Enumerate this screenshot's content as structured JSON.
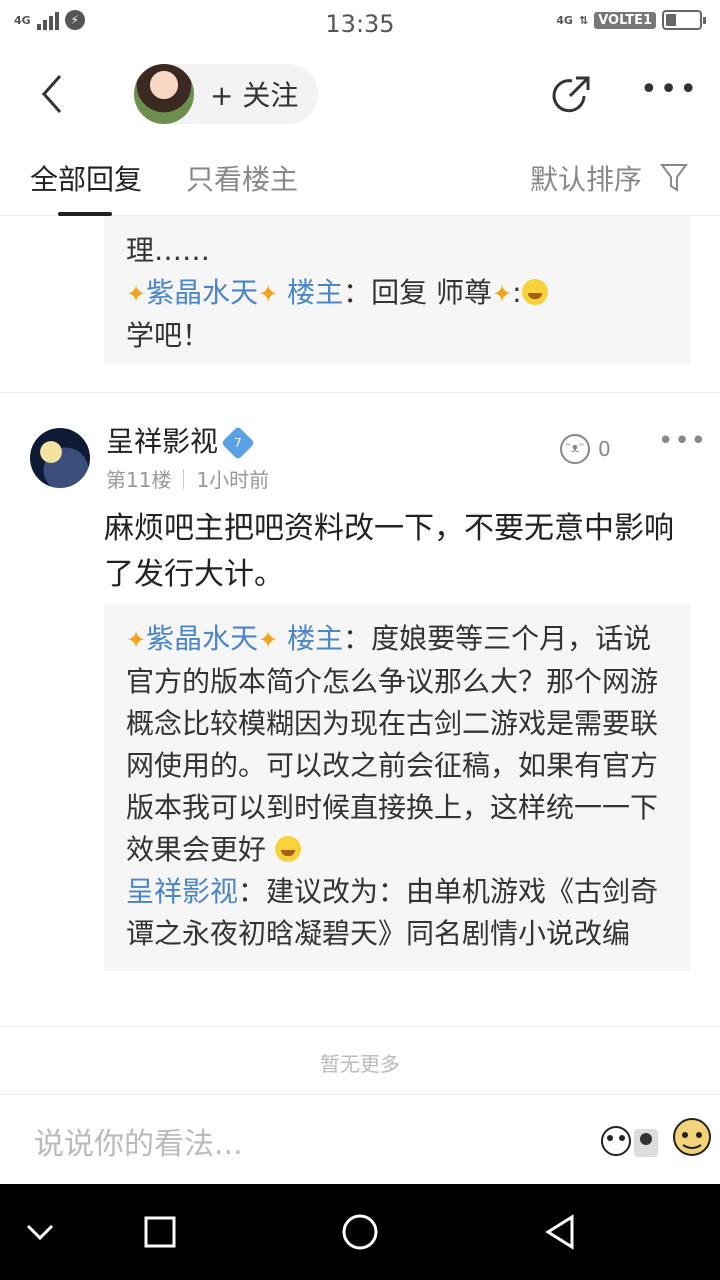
{
  "status_bar": {
    "time": "13:35",
    "signal_left": "4G",
    "signal_right": "4G",
    "volte": "VOLTE1"
  },
  "nav": {
    "follow_label": "+ 关注"
  },
  "tabs": {
    "all_replies": "全部回复",
    "owner_only": "只看楼主",
    "sort": "默认排序"
  },
  "top_quote": {
    "line_fragment": "理……",
    "reply_author": "紫晶水天",
    "reply_role": "楼主",
    "reply_text": "：回复 师尊",
    "reply_text2": "学吧！"
  },
  "post": {
    "author": "呈祥影视",
    "level_badge": "7",
    "floor": "第11楼",
    "time": "1小时前",
    "likes": "0",
    "body": "麻烦吧主把吧资料改一下，不要无意中影响了发行大计。",
    "quote": {
      "author1": "紫晶水天",
      "role1": "楼主",
      "text1": "：度娘要等三个月，话说官方的版本简介怎么争议那么大？那个网游概念比较模糊因为现在古剑二游戏是需要联网使用的。可以改之前会征稿，如果有官方版本我可以到时候直接换上，这样统一一下效果会更好",
      "author2": "呈祥影视",
      "text2": "：建议改为：由单机游戏《古剑奇谭之永夜初晗凝碧天》同名剧情小说改编"
    }
  },
  "footer": {
    "no_more": "暂无更多",
    "input_placeholder": "说说你的看法..."
  },
  "icons": {
    "back": "back-icon",
    "share": "share-icon",
    "more": "more-icon",
    "filter": "filter-icon",
    "like": "like-icon"
  },
  "colors": {
    "link_blue": "#4a86c8",
    "sparkle": "#f2a41d"
  }
}
